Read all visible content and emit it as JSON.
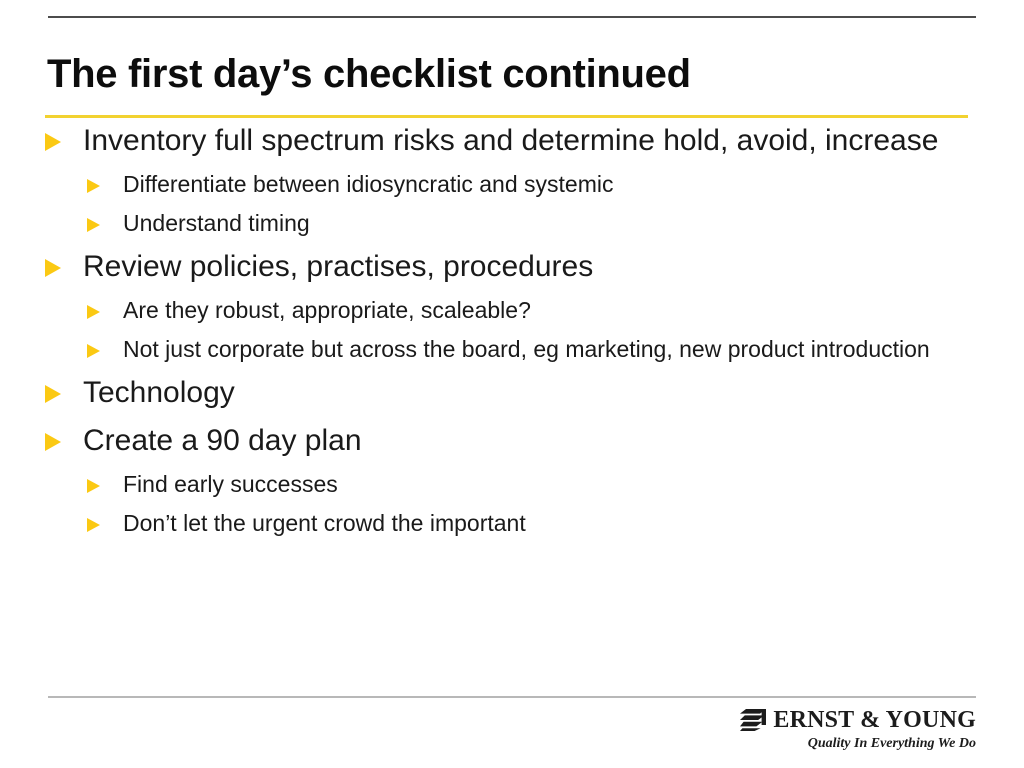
{
  "slide": {
    "title": "The first day’s checklist continued",
    "accent_color": "#f2d230",
    "bullet_color": "#fbc913",
    "text_color": "#1a1a1a",
    "background_color": "#ffffff",
    "top_rule_color": "#4c4c4c",
    "footer_rule_color": "#b8b8b8"
  },
  "content": {
    "bullets": [
      {
        "level": 1,
        "text": "Inventory full spectrum risks and determine hold, avoid, increase"
      },
      {
        "level": 2,
        "text": "Differentiate between idiosyncratic and systemic"
      },
      {
        "level": 2,
        "text": "Understand timing"
      },
      {
        "level": 1,
        "text": "Review policies, practises, procedures"
      },
      {
        "level": 2,
        "text": "Are they robust, appropriate, scaleable?"
      },
      {
        "level": 2,
        "text": "Not just corporate but across the board, eg marketing, new product introduction"
      },
      {
        "level": 1,
        "text": "Technology"
      },
      {
        "level": 1,
        "text": "Create a 90 day plan"
      },
      {
        "level": 2,
        "text": "Find early successes"
      },
      {
        "level": 2,
        "text": "Don’t let the urgent crowd the important"
      }
    ]
  },
  "footer": {
    "logo_name": "Ernst & Young",
    "logo_wordmark": "ERNST & YOUNG",
    "logo_tagline": "Quality In Everything We Do"
  }
}
